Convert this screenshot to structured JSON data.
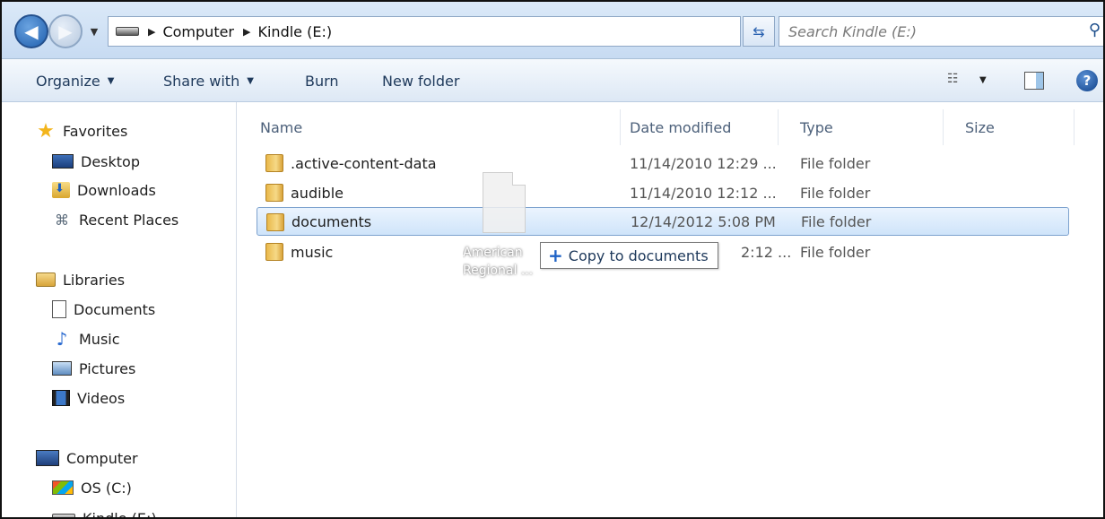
{
  "address": {
    "crumbs": [
      "Computer",
      "Kindle (E:)"
    ]
  },
  "search": {
    "placeholder": "Search Kindle (E:)"
  },
  "toolbar": {
    "organize": "Organize",
    "share_with": "Share with",
    "burn": "Burn",
    "new_folder": "New folder"
  },
  "nav": {
    "favorites": "Favorites",
    "desktop": "Desktop",
    "downloads": "Downloads",
    "recent_places": "Recent Places",
    "libraries": "Libraries",
    "documents": "Documents",
    "music": "Music",
    "pictures": "Pictures",
    "videos": "Videos",
    "computer": "Computer",
    "os_c": "OS (C:)",
    "kindle_e": "Kindle (E:)"
  },
  "columns": {
    "name": "Name",
    "date_modified": "Date modified",
    "type": "Type",
    "size": "Size"
  },
  "files": [
    {
      "name": ".active-content-data",
      "date": "11/14/2010 12:29 ...",
      "type": "File folder"
    },
    {
      "name": "audible",
      "date": "11/14/2010 12:12 ...",
      "type": "File folder"
    },
    {
      "name": "documents",
      "date": "12/14/2012 5:08 PM",
      "type": "File folder"
    },
    {
      "name": "music",
      "date": "2:12 ...",
      "type": "File folder"
    }
  ],
  "drag": {
    "file_label_line1": "American",
    "file_label_line2": "Regional ...",
    "tooltip": "Copy to documents"
  },
  "colors": {
    "selection": "#cfe4fa",
    "toolbar_text": "#1e395b"
  }
}
